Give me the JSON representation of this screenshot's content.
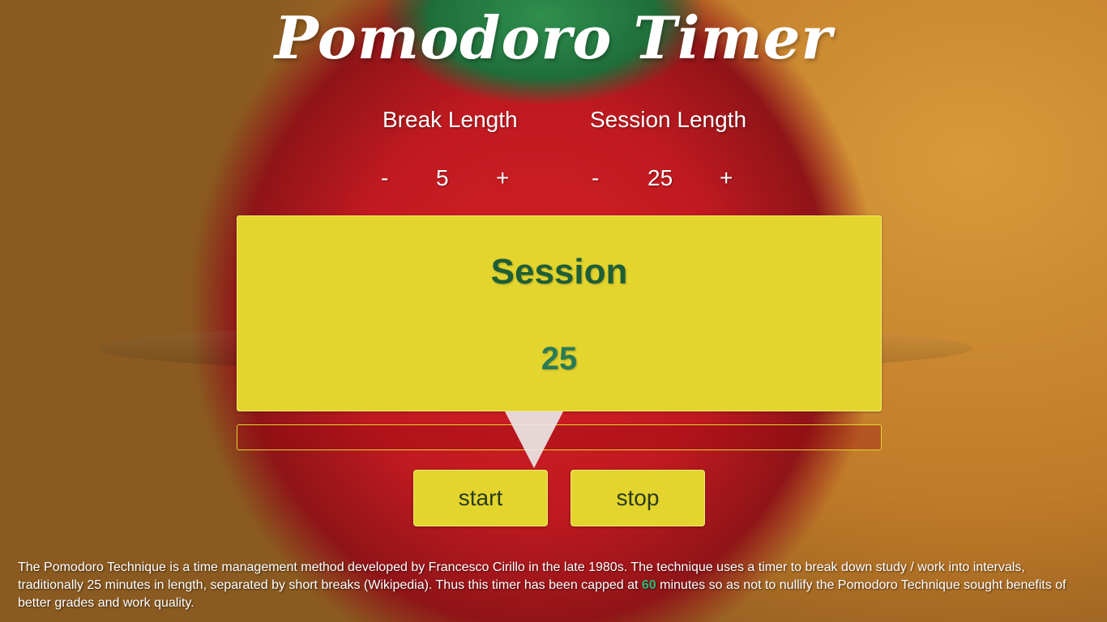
{
  "app": {
    "title": "Pomodoro Timer"
  },
  "break": {
    "label": "Break Length",
    "decrement": "-",
    "value": "5",
    "increment": "+"
  },
  "session": {
    "label": "Session Length",
    "decrement": "-",
    "value": "25",
    "increment": "+"
  },
  "display": {
    "mode": "Session",
    "time": "25"
  },
  "controls": {
    "start_label": "start",
    "stop_label": "stop"
  },
  "footer": {
    "text_part1": "The Pomodoro Technique is a time management method developed by Francesco Cirillo in the late 1980s. The technique uses a timer to break down study / work into intervals, traditionally 25 minutes in length, separated by short breaks (Wikipedia). Thus this timer has been capped at ",
    "cap_value": "60",
    "text_part2": " minutes so as not to nullify the Pomodoro Technique sought benefits of better grades and work quality."
  },
  "colors": {
    "panel": "#e3d52e",
    "session_text": "#1e5e36",
    "time_text": "#2a7a57",
    "highlight": "#2eb87a"
  }
}
